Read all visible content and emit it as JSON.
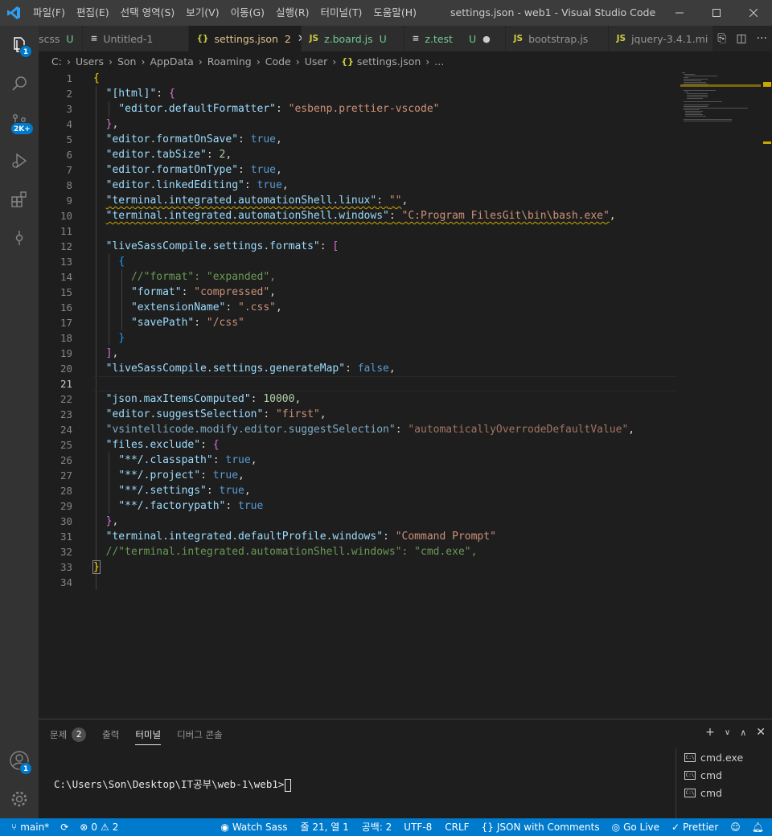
{
  "window": {
    "title": "settings.json - web1 - Visual Studio Code",
    "menu": [
      "파일(F)",
      "편집(E)",
      "선택 영역(S)",
      "보기(V)",
      "이동(G)",
      "실행(R)",
      "터미널(T)",
      "도움말(H)"
    ]
  },
  "activity": {
    "explorer_badge": "1",
    "scm_badge": "2K+",
    "accounts_badge": "1"
  },
  "tabs": [
    {
      "icon": "",
      "label": "scss",
      "status": "U",
      "active": false
    },
    {
      "icon": "≡",
      "label": "Untitled-1",
      "status": "",
      "active": false
    },
    {
      "icon": "{}",
      "label": "settings.json",
      "status": "2",
      "active": true
    },
    {
      "icon": "JS",
      "label": "z.board.js",
      "status": "U",
      "active": false
    },
    {
      "icon": "≡",
      "label": "z.test",
      "status": "U",
      "active": false
    },
    {
      "icon": "JS",
      "label": "bootstrap.js",
      "status": "",
      "active": false
    },
    {
      "icon": "JS",
      "label": "jquery-3.4.1.mi",
      "status": "",
      "active": false
    }
  ],
  "breadcrumb": {
    "items": [
      "C:",
      "Users",
      "Son",
      "AppData",
      "Roaming",
      "Code",
      "User"
    ],
    "file": "settings.json",
    "more": "..."
  },
  "editor": {
    "line_numbers": [
      "1",
      "2",
      "3",
      "4",
      "5",
      "6",
      "7",
      "8",
      "9",
      "10",
      "11",
      "12",
      "13",
      "14",
      "15",
      "16",
      "17",
      "18",
      "19",
      "20",
      "21",
      "22",
      "23",
      "24",
      "25",
      "26",
      "27",
      "28",
      "29",
      "30",
      "31",
      "32",
      "33",
      "34"
    ],
    "current_line": 21
  },
  "panel": {
    "tabs": [
      {
        "label": "문제",
        "badge": "2"
      },
      {
        "label": "출력",
        "badge": ""
      },
      {
        "label": "터미널",
        "badge": ""
      },
      {
        "label": "디버그 콘솔",
        "badge": ""
      }
    ],
    "terminal_prompt": "C:\\Users\\Son\\Desktop\\IT공부\\web-1\\web1>",
    "terminals": [
      "cmd.exe",
      "cmd",
      "cmd"
    ]
  },
  "status": {
    "branch": "main*",
    "errors": "0",
    "warnings": "2",
    "watch_sass": "Watch Sass",
    "position": "줄 21, 열 1",
    "spaces": "공백: 2",
    "encoding": "UTF-8",
    "eol": "CRLF",
    "language": "JSON with Comments",
    "go_live": "Go Live",
    "prettier": "Prettier"
  }
}
